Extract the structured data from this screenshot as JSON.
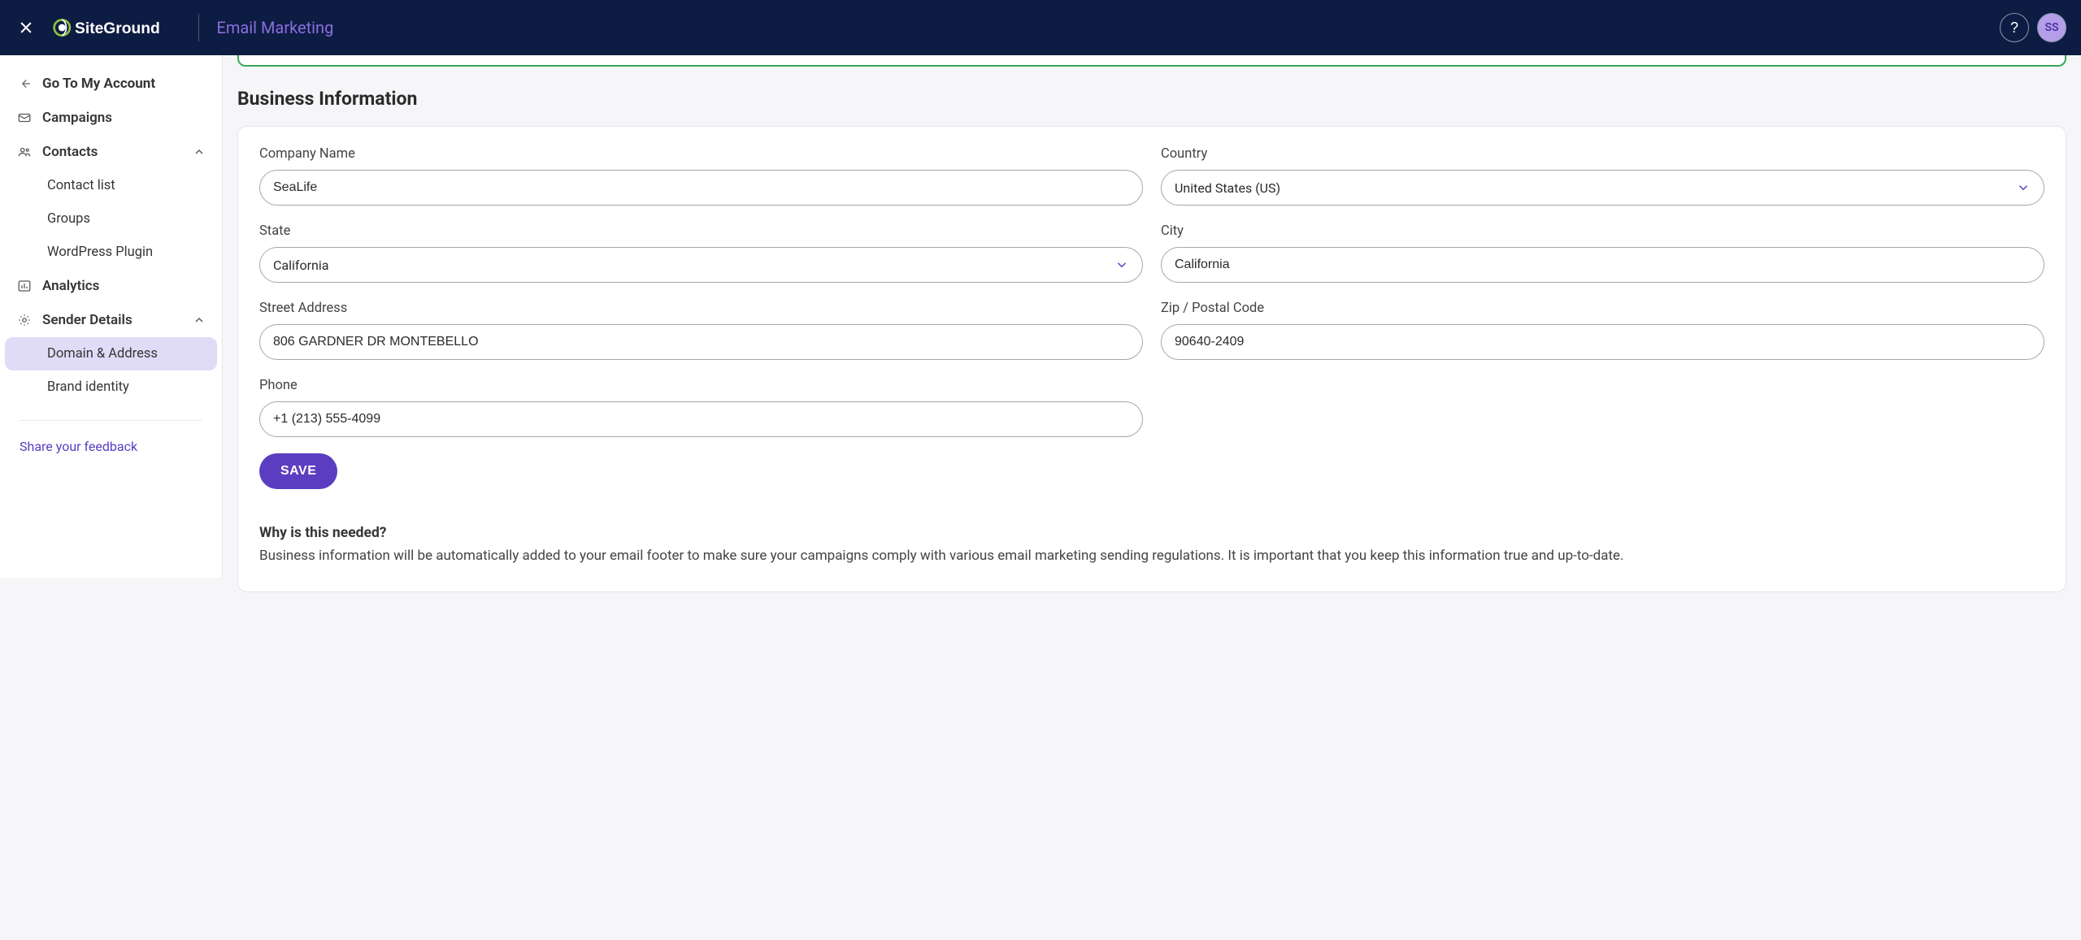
{
  "header": {
    "section": "Email Marketing",
    "avatar_initials": "SS"
  },
  "sidebar": {
    "go_back": "Go To My Account",
    "campaigns": "Campaigns",
    "contacts": "Contacts",
    "contact_list": "Contact list",
    "groups": "Groups",
    "wp_plugin": "WordPress Plugin",
    "analytics": "Analytics",
    "sender_details": "Sender Details",
    "domain_address": "Domain & Address",
    "brand_identity": "Brand identity",
    "feedback": "Share your feedback"
  },
  "main": {
    "heading": "Business Information",
    "labels": {
      "company": "Company Name",
      "country": "Country",
      "state": "State",
      "city": "City",
      "street": "Street Address",
      "zip": "Zip / Postal Code",
      "phone": "Phone"
    },
    "values": {
      "company": "SeaLife",
      "country": "United States (US)",
      "state": "California",
      "city": "California",
      "street": "806 GARDNER DR MONTEBELLO",
      "zip": "90640-2409",
      "phone": "+1 (213) 555-4099"
    },
    "save": "SAVE",
    "info_heading": "Why is this needed?",
    "info_text": "Business information will be automatically added to your email footer to make sure your campaigns comply with various email marketing sending regulations. It is important that you keep this information true and up-to-date."
  }
}
